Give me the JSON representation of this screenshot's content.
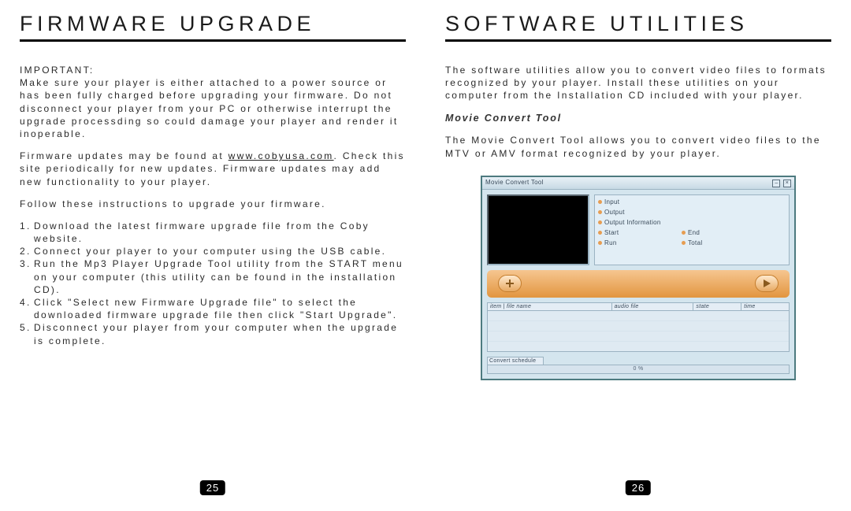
{
  "left": {
    "title": "FIRMWARE UPGRADE",
    "important_label": "IMPORTANT:",
    "important_body": "Make sure your player is either attached to a power source or has been fully charged before upgrading your firmware. Do not disconnect your player from your PC or otherwise interrupt the upgrade processding so could damage your player and render it inoperable.",
    "updates_a": "Firmware updates may be found at ",
    "updates_link": "www.cobyusa.com",
    "updates_b": ". Check this site periodically for new updates. Firmware updates may add new functionality to your player.",
    "follow": "Follow these instructions to upgrade your firmware.",
    "steps": [
      "Download the latest firmware upgrade file from the Coby website.",
      "Connect your player to your computer using the USB cable.",
      "Run the Mp3 Player Upgrade Tool utility from the START menu on your computer (this utility can be found in the installation CD).",
      "Click \"Select new Firmware Upgrade file\" to select the downloaded firmware upgrade file then click \"Start Upgrade\".",
      "Disconnect your player from your computer when the upgrade is complete."
    ],
    "page_num": "25"
  },
  "right": {
    "title": "SOFTWARE UTILITIES",
    "intro": "The software utilities allow you to convert video files to formats recognized by your player. Install these utilities on your computer from the Installation CD included with your player.",
    "tool_heading": "Movie Convert Tool",
    "tool_body": "The Movie Convert Tool allows you to convert video files to the MTV or AMV format recognized by your player.",
    "page_num": "26"
  },
  "mc": {
    "window_title": "Movie Convert Tool",
    "fields": {
      "input": "Input",
      "output": "Output",
      "output_info": "Output Information",
      "start": "Start",
      "end": "End",
      "run": "Run",
      "total": "Total"
    },
    "cols": {
      "c1": "item | file name",
      "c2": "audio file",
      "c3": "state",
      "c4": "time"
    },
    "schedule_label": "Convert schedule",
    "progress_text": "0 %"
  }
}
